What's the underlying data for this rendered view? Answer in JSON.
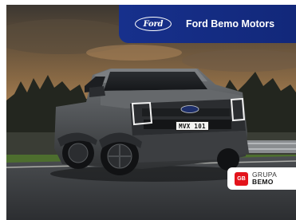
{
  "banner": {
    "logo_text": "Ford",
    "dealer_name": "Ford Bemo Motors",
    "color": "#17308c"
  },
  "vehicle": {
    "license_plate": "MVX 101",
    "grille_logo_text": "Ford"
  },
  "group_badge": {
    "icon_text": "GB",
    "line1": "GRUPA",
    "line2": "BEMO",
    "icon_color": "#e3131b"
  }
}
